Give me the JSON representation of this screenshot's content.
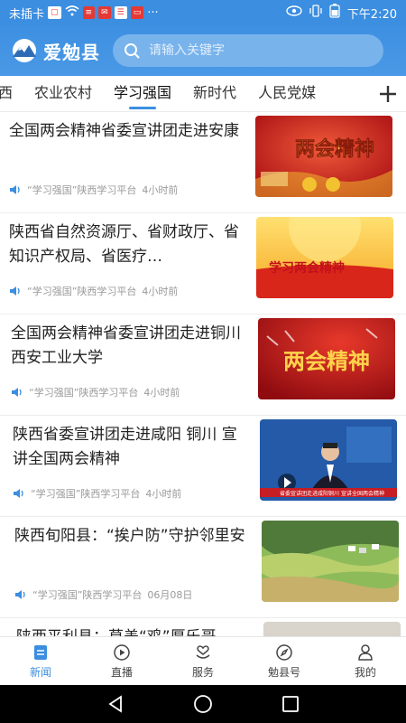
{
  "status_bar": {
    "carrier": "未插卡",
    "time": "下午2:20"
  },
  "header": {
    "app_name": "爱勉县",
    "search_placeholder": "请输入关键字"
  },
  "tabs": [
    {
      "label": "西"
    },
    {
      "label": "农业农村"
    },
    {
      "label": "学习强国",
      "active": true
    },
    {
      "label": "新时代"
    },
    {
      "label": "人民党媒"
    }
  ],
  "feed": [
    {
      "title": "全国两会精神省委宣讲团走进安康",
      "source": "“学习强国”陕西学习平台",
      "time": "4小时前",
      "thumb_text": "两会精神"
    },
    {
      "title": "陕西省自然资源厅、省财政厅、省知识产权局、省医疗…",
      "source": "“学习强国”陕西学习平台",
      "time": "4小时前",
      "thumb_text": "学习两会精神"
    },
    {
      "title": "全国两会精神省委宣讲团走进铜川 西安工业大学",
      "source": "“学习强国”陕西学习平台",
      "time": "4小时前",
      "thumb_text": "两会精神"
    },
    {
      "title": "陕西省委宣讲团走进咸阳 铜川 宣讲全国两会精神",
      "source": "“学习强国”陕西学习平台",
      "time": "4小时前",
      "thumb_text": "省委宣讲团走进咸阳铜川 宣讲全国两会精神"
    },
    {
      "title": "陕西旬阳县：“挨户防”守护邻里安",
      "source": "“学习强国”陕西学习平台",
      "time": "06月08日",
      "thumb_text": ""
    },
    {
      "title": "陕西平利县：草盖“鸡”厚乐哥",
      "source": "",
      "time": "",
      "thumb_text": ""
    }
  ],
  "bottom_nav": [
    {
      "label": "新闻",
      "icon": "news-icon",
      "active": true
    },
    {
      "label": "直播",
      "icon": "play-icon"
    },
    {
      "label": "服务",
      "icon": "service-icon"
    },
    {
      "label": "勉县号",
      "icon": "compass-icon"
    },
    {
      "label": "我的",
      "icon": "user-icon"
    }
  ],
  "colors": {
    "brand": "#3b8ee0",
    "festive_red": "#c8161d",
    "gold": "#f2c230"
  }
}
